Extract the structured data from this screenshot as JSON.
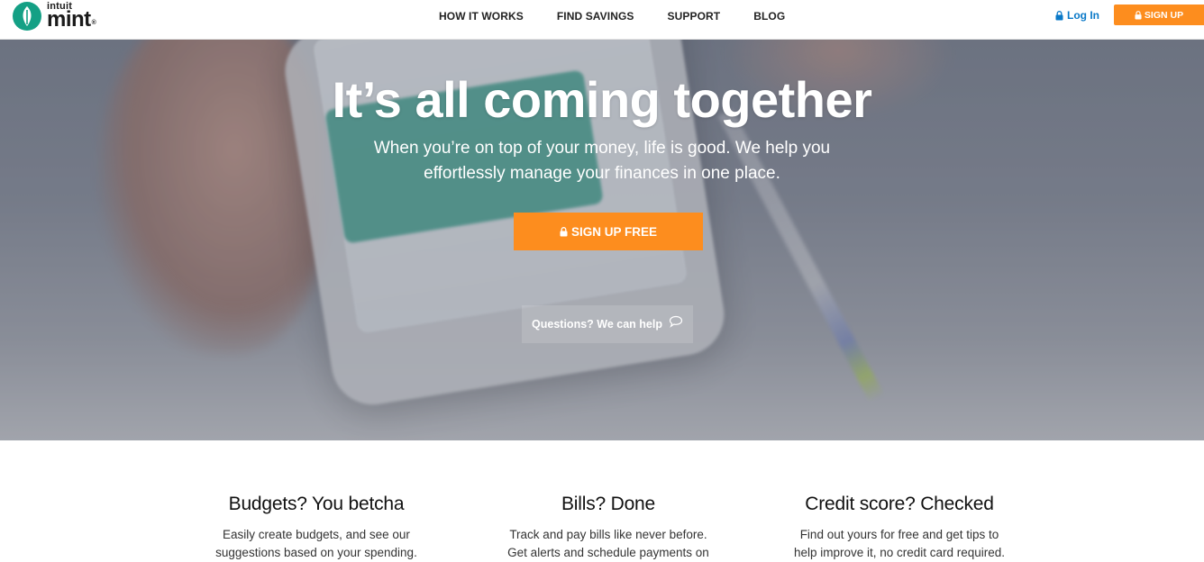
{
  "header": {
    "logo_top": "intuit",
    "logo_main": "mint",
    "nav": [
      "HOW IT WORKS",
      "FIND SAVINGS",
      "SUPPORT",
      "BLOG"
    ],
    "login_label": "Log In",
    "signup_label": "SIGN UP"
  },
  "hero": {
    "title": "It’s all coming together",
    "subtitle_line1": "When you’re on top of your money, life is good. We help you",
    "subtitle_line2": "effortlessly manage your finances in one place.",
    "cta_label": "SIGN UP FREE",
    "help_label": "Questions? We can help"
  },
  "features": [
    {
      "title": "Budgets? You betcha",
      "line1": "Easily create budgets, and see our",
      "line2": "suggestions based on your spending."
    },
    {
      "title": "Bills? Done",
      "line1": "Track and pay bills like never before.",
      "line2": "Get alerts and schedule payments on"
    },
    {
      "title": "Credit score? Checked",
      "line1": "Find out yours for free and get tips to",
      "line2": "help improve it, no credit card required."
    }
  ],
  "colors": {
    "accent": "#fd8d1e",
    "brand": "#14a085",
    "link": "#0a79c8"
  },
  "icons": {
    "logo": "mint-leaf-icon",
    "lock": "lock-icon",
    "chat": "chat-bubble-icon"
  }
}
